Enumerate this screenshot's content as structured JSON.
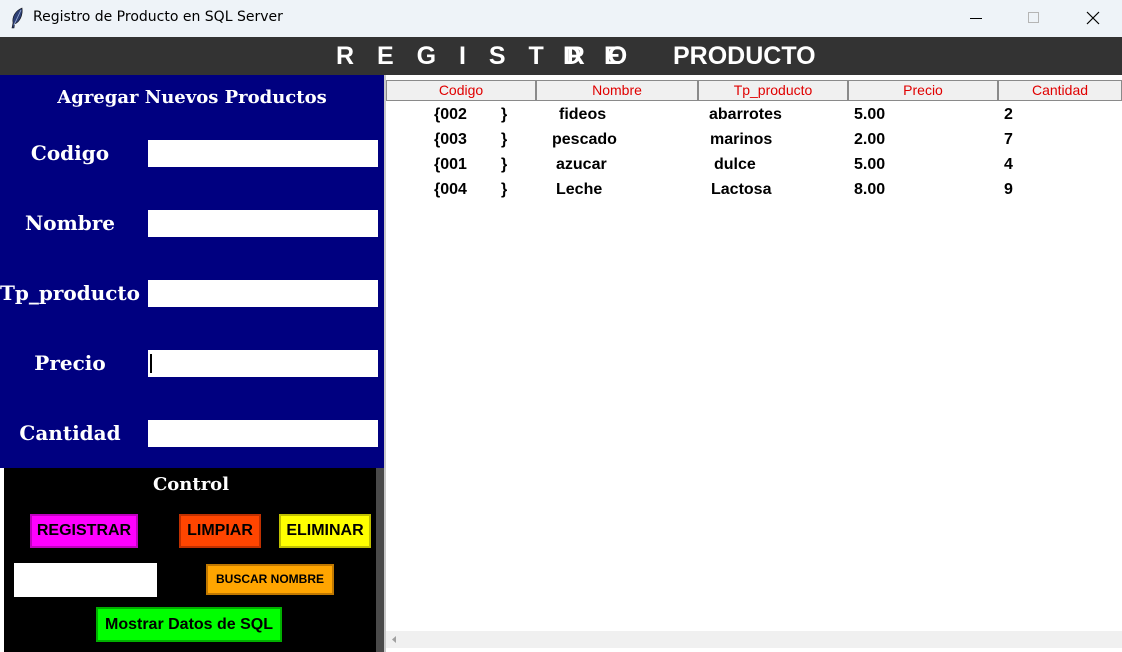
{
  "window": {
    "title": "Registro de Producto en SQL Server"
  },
  "header": {
    "word1": "R E G I S T R O",
    "word2": "D E",
    "word3": "PRODUCTO"
  },
  "form": {
    "title": "Agregar Nuevos Productos",
    "fields": [
      {
        "label": "Codigo",
        "value": ""
      },
      {
        "label": "Nombre",
        "value": ""
      },
      {
        "label": "Tp_producto",
        "value": ""
      },
      {
        "label": "Precio",
        "value": ""
      },
      {
        "label": "Cantidad",
        "value": ""
      }
    ]
  },
  "control": {
    "title": "Control",
    "registrar": "REGISTRAR",
    "limpiar": "LIMPIAR",
    "eliminar": "ELIMINAR",
    "search_value": "",
    "buscar": "BUSCAR NOMBRE",
    "mostrar": "Mostrar Datos de SQL"
  },
  "table": {
    "columns": [
      "Codigo",
      "Nombre",
      "Tp_producto",
      "Precio",
      "Cantidad"
    ],
    "rows": [
      {
        "code": "{002",
        "brace": "}",
        "nombre": "fideos",
        "tipo": "abarrotes",
        "precio": "5.00",
        "cantidad": "2"
      },
      {
        "code": "{003",
        "brace": "}",
        "nombre": "pescado",
        "tipo": "marinos",
        "precio": "2.00",
        "cantidad": "7"
      },
      {
        "code": "{001",
        "brace": "}",
        "nombre": "azucar",
        "tipo": "dulce",
        "precio": "5.00",
        "cantidad": "4"
      },
      {
        "code": "{004",
        "brace": "}",
        "nombre": "Leche",
        "tipo": "Lactosa",
        "precio": "8.00",
        "cantidad": "9"
      }
    ]
  },
  "colors": {
    "form_bg": "#000080",
    "header_bg": "#333333",
    "registrar": "#ff00ff",
    "limpiar": "#ff4500",
    "eliminar": "#ffff00",
    "buscar": "#ffa500",
    "mostrar": "#00ff00",
    "column_header_text": "#e00000"
  },
  "icons": {
    "app": "feather-icon",
    "minimize": "minimize-icon",
    "maximize": "maximize-icon",
    "close": "close-icon"
  }
}
